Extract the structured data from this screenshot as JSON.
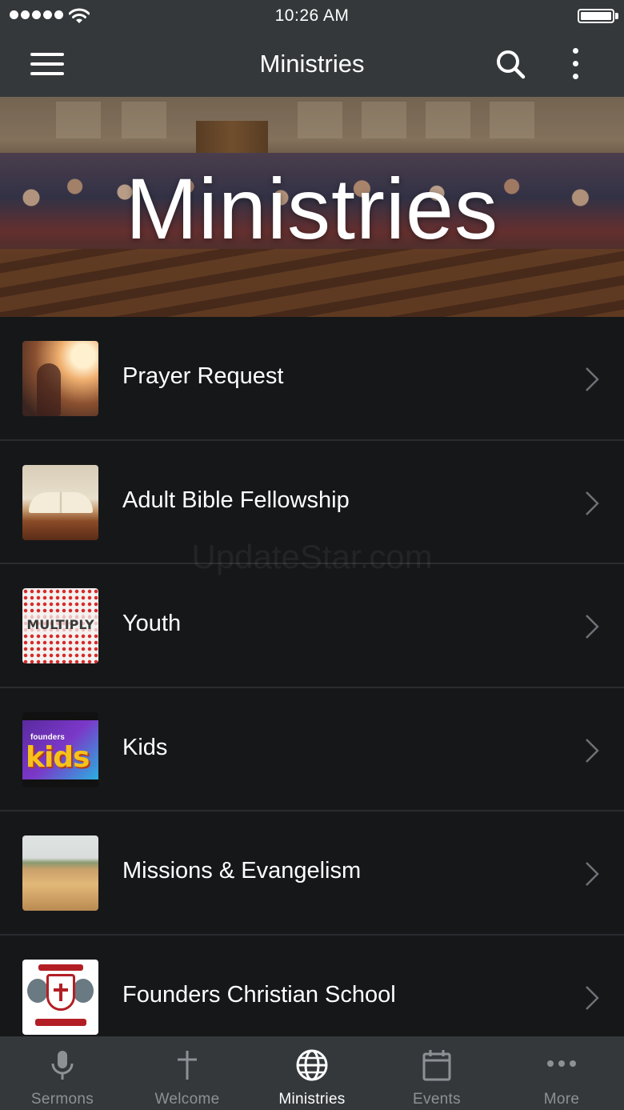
{
  "status_bar": {
    "time": "10:26 AM",
    "signal_icon": "signal-dots-icon",
    "wifi_icon": "wifi-icon",
    "battery_icon": "battery-icon"
  },
  "header": {
    "title": "Ministries",
    "menu_icon": "hamburger-menu-icon",
    "search_icon": "search-icon",
    "more_icon": "more-vertical-icon"
  },
  "hero": {
    "title": "Ministries"
  },
  "watermark": "UpdateStar.com",
  "list": {
    "items": [
      {
        "label": "Prayer Request",
        "thumb": "prayer-thumbnail"
      },
      {
        "label": "Adult Bible Fellowship",
        "thumb": "bible-thumbnail"
      },
      {
        "label": "Youth",
        "thumb": "youth-thumbnail",
        "thumb_text": "MULTIPLY"
      },
      {
        "label": "Kids",
        "thumb": "kids-thumbnail",
        "thumb_small": "founders",
        "thumb_big": "kids"
      },
      {
        "label": "Missions & Evangelism",
        "thumb": "missions-thumbnail"
      },
      {
        "label": "Founders Christian School",
        "thumb": "school-thumbnail"
      }
    ],
    "chevron_icon": "chevron-right-icon"
  },
  "tab_bar": {
    "tabs": [
      {
        "label": "Sermons",
        "icon": "microphone-icon",
        "active": false
      },
      {
        "label": "Welcome",
        "icon": "cross-icon",
        "active": false
      },
      {
        "label": "Ministries",
        "icon": "globe-icon",
        "active": true
      },
      {
        "label": "Events",
        "icon": "calendar-icon",
        "active": false
      },
      {
        "label": "More",
        "icon": "more-horizontal-icon",
        "active": false
      }
    ]
  },
  "colors": {
    "bar_background": "#34383b",
    "list_background": "#161719",
    "divider": "#2a2c2f",
    "inactive_tab": "#8e9194",
    "active_tab": "#ffffff"
  }
}
